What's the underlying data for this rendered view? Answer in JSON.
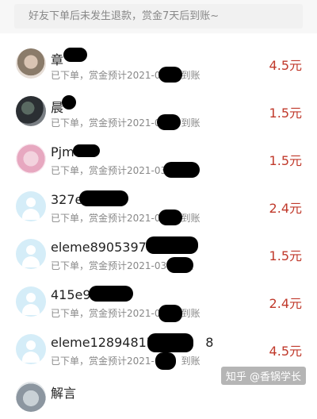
{
  "notice": "好友下单后未发生退款，赏金7天后到账~",
  "rows": [
    {
      "name": "章",
      "status": "已下单，赏金预计2021-0",
      "status_tail": "到账",
      "amount": "4.5元",
      "avatar": "photo1"
    },
    {
      "name": "晨",
      "status": "已下单，赏金预计2021-0",
      "status_tail": "到账",
      "amount": "1.5元",
      "avatar": "photo2"
    },
    {
      "name": "Pjm",
      "status": "已下单，赏金预计2021-03",
      "status_tail": "",
      "amount": "1.5元",
      "avatar": "photo3"
    },
    {
      "name": "327e",
      "status": "已下单，赏金预计2021-0",
      "status_tail": "到账",
      "amount": "2.4元",
      "avatar": "default"
    },
    {
      "name": "eleme89053976",
      "status": "已下单，赏金预计2021-03",
      "status_tail": "到账",
      "amount": "1.5元",
      "avatar": "default"
    },
    {
      "name": "415e96",
      "status": "已下单，赏金预计2021-0",
      "status_tail": "到账",
      "amount": "2.4元",
      "avatar": "default"
    },
    {
      "name": "eleme128948176",
      "name_tail": "8",
      "status": "已下单，赏金预计2021-0",
      "status_tail": "到账",
      "amount": "4.5元",
      "avatar": "default"
    },
    {
      "name": "解言",
      "status": "",
      "status_tail": "",
      "amount": "",
      "avatar": "photo4"
    }
  ],
  "watermark": "知乎 @香锅学长",
  "colors": {
    "amount": "#c0392b",
    "avatar_default": "#d5edf8"
  }
}
